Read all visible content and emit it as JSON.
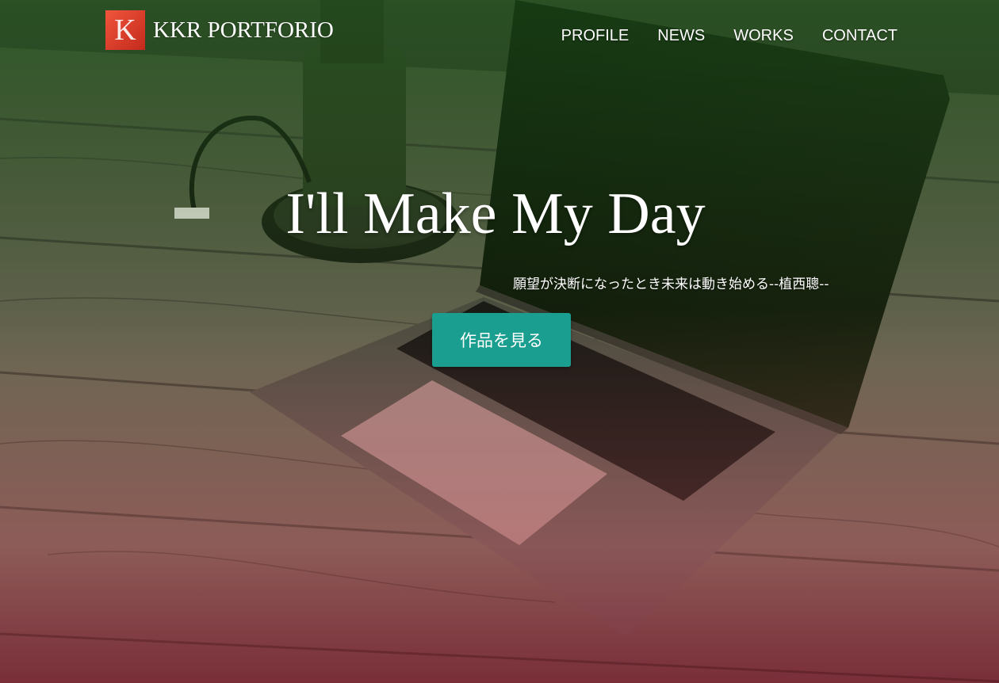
{
  "brand": {
    "logo_letter": "K",
    "name": "KKR PORTFORIO"
  },
  "nav": {
    "items": [
      {
        "label": "PROFILE"
      },
      {
        "label": "NEWS"
      },
      {
        "label": "WORKS"
      },
      {
        "label": "CONTACT"
      }
    ]
  },
  "hero": {
    "headline": "I'll Make My Day",
    "quote": "願望が決断になったとき未来は動き始める--植西聰--",
    "cta_label": "作品を見る"
  },
  "colors": {
    "accent": "#1a9e8f",
    "logo": "#e2412b"
  }
}
